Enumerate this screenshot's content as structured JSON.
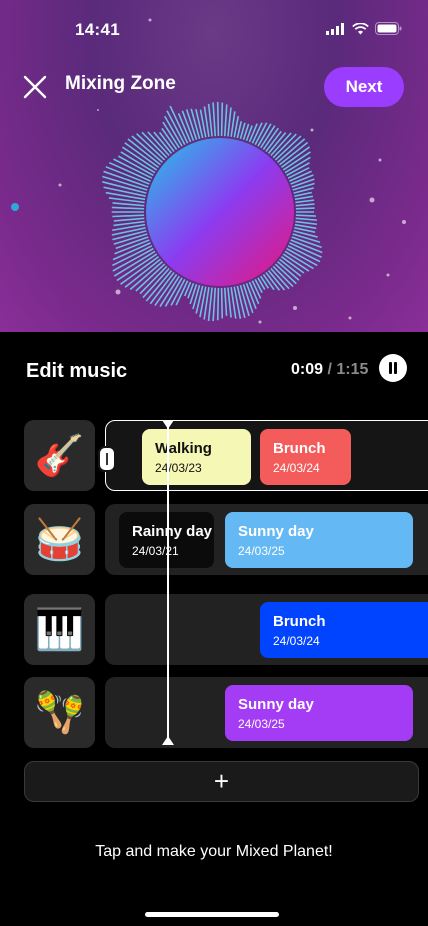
{
  "status": {
    "time": "14:41"
  },
  "header": {
    "title": "Mixing Zone",
    "next_label": "Next"
  },
  "editor": {
    "title": "Edit music",
    "current_time": "0:09",
    "separator": " / ",
    "total_time": "1:15"
  },
  "tracks": [
    {
      "instrument": "guitar",
      "icon": "🎸",
      "clips": [
        {
          "name": "Walking",
          "date": "24/03/23",
          "color": "#f5f7b5",
          "text_color": "#111111"
        },
        {
          "name": "Brunch",
          "date": "24/03/24",
          "color": "#f45c5c",
          "text_color": "#ffffff"
        }
      ]
    },
    {
      "instrument": "drum",
      "icon": "🥁",
      "clips": [
        {
          "name": "Rainny day",
          "date": "24/03/21",
          "color": "#0b0b0b",
          "text_color": "#ffffff"
        },
        {
          "name": "Sunny day",
          "date": "24/03/25",
          "color": "#64b9f5",
          "text_color": "#ffffff"
        }
      ]
    },
    {
      "instrument": "piano",
      "icon": "🎹",
      "clips": [
        {
          "name": "Brunch",
          "date": "24/03/24",
          "color": "#0044ff",
          "text_color": "#ffffff"
        }
      ]
    },
    {
      "instrument": "maracas",
      "icon": "🪇",
      "clips": [
        {
          "name": "Sunny day",
          "date": "24/03/25",
          "color": "#a43cf5",
          "text_color": "#ffffff"
        }
      ]
    }
  ],
  "add_label": "+",
  "hint": "Tap and make your Mixed Planet!",
  "colors": {
    "accent": "#9b3dff"
  }
}
